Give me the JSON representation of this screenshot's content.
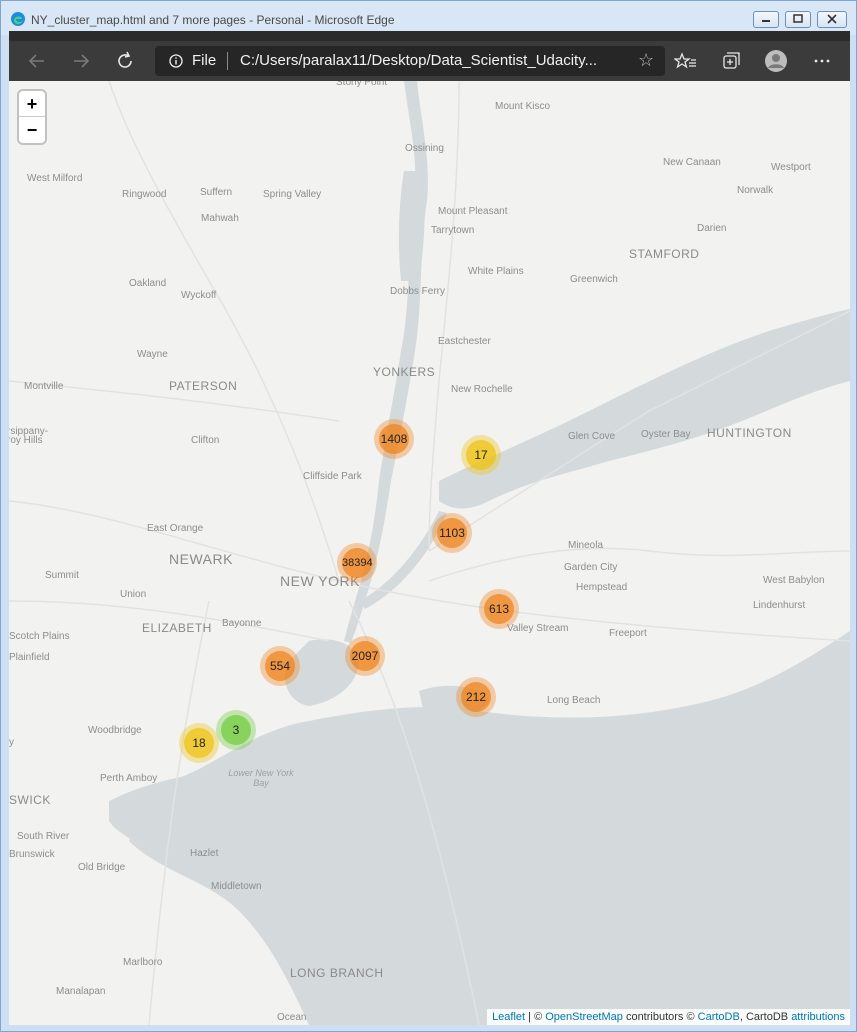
{
  "window": {
    "title": "NY_cluster_map.html and 7 more pages - Personal - Microsoft Edge"
  },
  "toolbar": {
    "file_label": "File",
    "url": "C:/Users/paralax11/Desktop/Data_Scientist_Udacity..."
  },
  "map": {
    "zoom_in": "+",
    "zoom_out": "−",
    "labels": [
      {
        "id": "stony-point",
        "text": "Stony Point"
      },
      {
        "id": "mount-kisco",
        "text": "Mount Kisco"
      },
      {
        "id": "ossining",
        "text": "Ossining"
      },
      {
        "id": "new-canaan",
        "text": "New Canaan"
      },
      {
        "id": "west-milford",
        "text": "West Milford"
      },
      {
        "id": "ringwood",
        "text": "Ringwood"
      },
      {
        "id": "suffern",
        "text": "Suffern"
      },
      {
        "id": "spring-valley",
        "text": "Spring Valley"
      },
      {
        "id": "mahwah",
        "text": "Mahwah"
      },
      {
        "id": "westport",
        "text": "Westport"
      },
      {
        "id": "norwalk",
        "text": "Norwalk"
      },
      {
        "id": "mount-pleasant",
        "text": "Mount Pleasant"
      },
      {
        "id": "tarrytown",
        "text": "Tarrytown"
      },
      {
        "id": "darien",
        "text": "Darien"
      },
      {
        "id": "stamford",
        "text": "STAMFORD"
      },
      {
        "id": "white-plains",
        "text": "White Plains"
      },
      {
        "id": "greenwich",
        "text": "Greenwich"
      },
      {
        "id": "oakland",
        "text": "Oakland"
      },
      {
        "id": "wyckoff",
        "text": "Wyckoff"
      },
      {
        "id": "dobbs-ferry",
        "text": "Dobbs Ferry"
      },
      {
        "id": "eastchester",
        "text": "Eastchester"
      },
      {
        "id": "wayne",
        "text": "Wayne"
      },
      {
        "id": "yonkers",
        "text": "YONKERS"
      },
      {
        "id": "montville",
        "text": "Montville"
      },
      {
        "id": "paterson",
        "text": "PATERSON"
      },
      {
        "id": "new-rochelle",
        "text": "New Rochelle"
      },
      {
        "id": "parsippany",
        "text": "rsippany-"
      },
      {
        "id": "troy-hills",
        "text": "roy Hills"
      },
      {
        "id": "clifton",
        "text": "Clifton"
      },
      {
        "id": "glen-cove",
        "text": "Glen Cove"
      },
      {
        "id": "oyster-bay",
        "text": "Oyster Bay"
      },
      {
        "id": "huntington",
        "text": "HUNTINGTON"
      },
      {
        "id": "cliffside-park",
        "text": "Cliffside Park"
      },
      {
        "id": "east-orange",
        "text": "East Orange"
      },
      {
        "id": "mineola",
        "text": "Mineola"
      },
      {
        "id": "newark",
        "text": "NEWARK"
      },
      {
        "id": "garden-city",
        "text": "Garden City"
      },
      {
        "id": "summit",
        "text": "Summit"
      },
      {
        "id": "new-york",
        "text": "NEW YORK"
      },
      {
        "id": "hempstead",
        "text": "Hempstead"
      },
      {
        "id": "west-babylon",
        "text": "West Babylon"
      },
      {
        "id": "union",
        "text": "Union"
      },
      {
        "id": "lindenhurst",
        "text": "Lindenhurst"
      },
      {
        "id": "elizabeth",
        "text": "ELIZABETH"
      },
      {
        "id": "bayonne",
        "text": "Bayonne"
      },
      {
        "id": "valley-stream",
        "text": "Valley Stream"
      },
      {
        "id": "freeport",
        "text": "Freeport"
      },
      {
        "id": "scotch-plains",
        "text": "Scotch Plains"
      },
      {
        "id": "plainfield",
        "text": "Plainfield"
      },
      {
        "id": "long-beach",
        "text": "Long Beach"
      },
      {
        "id": "woodbridge",
        "text": "Woodbridge"
      },
      {
        "id": "perth-amboy",
        "text": "Perth Amboy"
      },
      {
        "id": "lower-ny-bay",
        "text": "Lower New York Bay"
      },
      {
        "id": "swick",
        "text": "SWICK"
      },
      {
        "id": "south-river",
        "text": "South River"
      },
      {
        "id": "brunswick",
        "text": "Brunswick"
      },
      {
        "id": "old-bridge",
        "text": "Old Bridge"
      },
      {
        "id": "hazlet",
        "text": "Hazlet"
      },
      {
        "id": "middletown",
        "text": "Middletown"
      },
      {
        "id": "marlboro",
        "text": "Marlboro"
      },
      {
        "id": "long-branch",
        "text": "LONG BRANCH"
      },
      {
        "id": "manalapan",
        "text": "Manalapan"
      },
      {
        "id": "ocean",
        "text": "Ocean"
      },
      {
        "id": "y-edge",
        "text": "y"
      }
    ],
    "clusters": [
      {
        "count": "1408",
        "level": "large"
      },
      {
        "count": "17",
        "level": "medium"
      },
      {
        "count": "1103",
        "level": "large"
      },
      {
        "count": "38394",
        "level": "large"
      },
      {
        "count": "613",
        "level": "large"
      },
      {
        "count": "554",
        "level": "large"
      },
      {
        "count": "2097",
        "level": "large"
      },
      {
        "count": "212",
        "level": "large"
      },
      {
        "count": "3",
        "level": "small"
      },
      {
        "count": "18",
        "level": "medium"
      }
    ],
    "cluster_colors": {
      "large": "#f18017",
      "medium": "#f0c20c",
      "small": "#6ecc39"
    },
    "water_color": "#d4dadc",
    "land_color": "#f2f2f0"
  },
  "attribution": {
    "leaflet": "Leaflet",
    "sep1": " | © ",
    "osm": "OpenStreetMap",
    "contrib": " contributors © ",
    "carto": "CartoDB",
    "mid": ", CartoDB ",
    "attr": "attributions"
  }
}
